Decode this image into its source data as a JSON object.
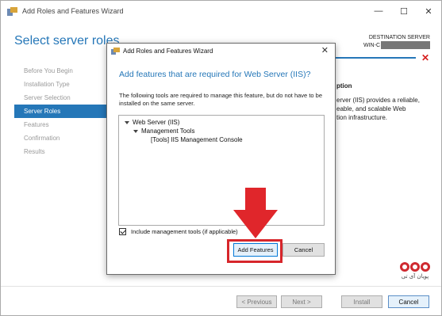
{
  "window": {
    "title": "Add Roles and Features Wizard",
    "min_glyph": "—",
    "max_glyph": "☐",
    "close_glyph": "✕"
  },
  "page": {
    "title": "Select server roles"
  },
  "destination": {
    "label": "DESTINATION SERVER",
    "server_prefix": "WIN-C"
  },
  "nav": {
    "items": [
      "Before You Begin",
      "Installation Type",
      "Server Selection",
      "Server Roles",
      "Features",
      "Confirmation",
      "Results"
    ],
    "active_index": 3
  },
  "description": {
    "heading": "ption",
    "lines": [
      "erver (IIS) provides a reliable,",
      "eable, and scalable Web",
      "tion infrastructure."
    ]
  },
  "dialog": {
    "title": "Add Roles and Features Wizard",
    "close_glyph": "✕",
    "heading": "Add features that are required for Web Server (IIS)?",
    "text": "The following tools are required to manage this feature, but do not have to be installed on the same server.",
    "tree": [
      {
        "label": "Web Server (IIS)",
        "level": 0,
        "expanded": true
      },
      {
        "label": "Management Tools",
        "level": 1,
        "expanded": true
      },
      {
        "label": "[Tools] IIS Management Console",
        "level": 2,
        "expanded": false
      }
    ],
    "checkbox_label": "Include management tools (if applicable)",
    "checkbox_checked": true,
    "add_button": "Add Features",
    "cancel_button": "Cancel"
  },
  "footer": {
    "previous": "< Previous",
    "next": "Next >",
    "install": "Install",
    "cancel": "Cancel"
  },
  "watermark": {
    "text": "پویان آی تی"
  },
  "colors": {
    "accent": "#2577b8",
    "highlight": "#d7262b"
  }
}
